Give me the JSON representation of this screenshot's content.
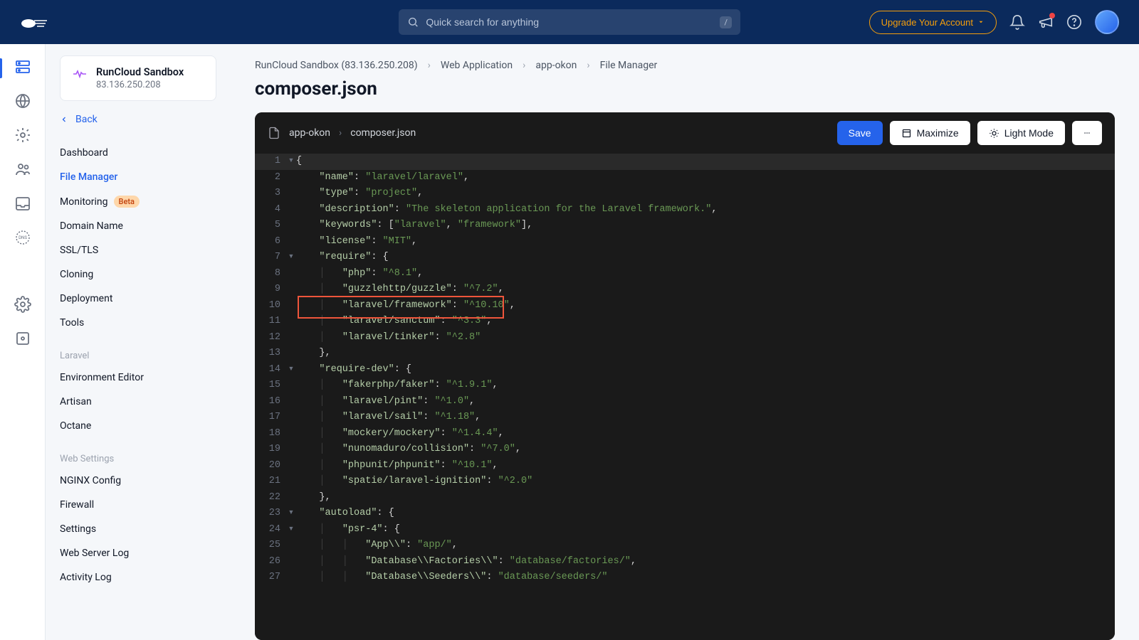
{
  "header": {
    "search_placeholder": "Quick search for anything",
    "search_kbd": "/",
    "upgrade_label": "Upgrade Your Account"
  },
  "server_card": {
    "title": "RunCloud Sandbox",
    "ip": "83.136.250.208"
  },
  "back_label": "Back",
  "nav": {
    "items": [
      {
        "label": "Dashboard"
      },
      {
        "label": "File Manager"
      },
      {
        "label": "Monitoring",
        "badge": "Beta"
      },
      {
        "label": "Domain Name"
      },
      {
        "label": "SSL/TLS"
      },
      {
        "label": "Cloning"
      },
      {
        "label": "Deployment"
      },
      {
        "label": "Tools"
      }
    ],
    "group1_label": "Laravel",
    "group1": [
      {
        "label": "Environment Editor"
      },
      {
        "label": "Artisan"
      },
      {
        "label": "Octane"
      }
    ],
    "group2_label": "Web Settings",
    "group2": [
      {
        "label": "NGINX Config"
      },
      {
        "label": "Firewall"
      },
      {
        "label": "Settings"
      },
      {
        "label": "Web Server Log"
      },
      {
        "label": "Activity Log"
      }
    ]
  },
  "breadcrumb": {
    "c1": "RunCloud Sandbox (83.136.250.208)",
    "c2": "Web Application",
    "c3": "app-okon",
    "c4": "File Manager"
  },
  "page_title": "composer.json",
  "toolbar": {
    "path1": "app-okon",
    "path2": "composer.json",
    "save": "Save",
    "maximize": "Maximize",
    "light": "Light Mode"
  },
  "code": {
    "lines": [
      {
        "n": 1,
        "fold": "▾",
        "tokens": [
          [
            "ob",
            "{"
          ]
        ]
      },
      {
        "n": 2,
        "tokens": [
          [
            "ws",
            "    "
          ],
          [
            "key",
            "\"name\""
          ],
          [
            "punc",
            ": "
          ],
          [
            "str",
            "\"laravel/laravel\""
          ],
          [
            "punc",
            ","
          ]
        ]
      },
      {
        "n": 3,
        "tokens": [
          [
            "ws",
            "    "
          ],
          [
            "key",
            "\"type\""
          ],
          [
            "punc",
            ": "
          ],
          [
            "str",
            "\"project\""
          ],
          [
            "punc",
            ","
          ]
        ]
      },
      {
        "n": 4,
        "tokens": [
          [
            "ws",
            "    "
          ],
          [
            "key",
            "\"description\""
          ],
          [
            "punc",
            ": "
          ],
          [
            "str",
            "\"The skeleton application for the Laravel framework.\""
          ],
          [
            "punc",
            ","
          ]
        ]
      },
      {
        "n": 5,
        "tokens": [
          [
            "ws",
            "    "
          ],
          [
            "key",
            "\"keywords\""
          ],
          [
            "punc",
            ": ["
          ],
          [
            "str",
            "\"laravel\""
          ],
          [
            "punc",
            ", "
          ],
          [
            "str",
            "\"framework\""
          ],
          [
            "punc",
            "],"
          ]
        ]
      },
      {
        "n": 6,
        "tokens": [
          [
            "ws",
            "    "
          ],
          [
            "key",
            "\"license\""
          ],
          [
            "punc",
            ": "
          ],
          [
            "str",
            "\"MIT\""
          ],
          [
            "punc",
            ","
          ]
        ]
      },
      {
        "n": 7,
        "fold": "▾",
        "tokens": [
          [
            "ws",
            "    "
          ],
          [
            "key",
            "\"require\""
          ],
          [
            "punc",
            ": {"
          ]
        ]
      },
      {
        "n": 8,
        "tokens": [
          [
            "ws",
            "    "
          ],
          [
            "guide",
            "│   "
          ],
          [
            "key",
            "\"php\""
          ],
          [
            "punc",
            ": "
          ],
          [
            "str",
            "\"^8.1\""
          ],
          [
            "punc",
            ","
          ]
        ]
      },
      {
        "n": 9,
        "tokens": [
          [
            "ws",
            "    "
          ],
          [
            "guide",
            "│   "
          ],
          [
            "key",
            "\"guzzlehttp/guzzle\""
          ],
          [
            "punc",
            ": "
          ],
          [
            "str",
            "\"^7.2\""
          ],
          [
            "punc",
            ","
          ]
        ]
      },
      {
        "n": 10,
        "highlight": true,
        "tokens": [
          [
            "ws",
            "    "
          ],
          [
            "guide",
            "│   "
          ],
          [
            "key",
            "\"laravel/framework\""
          ],
          [
            "punc",
            ": "
          ],
          [
            "str",
            "\"^10.10\""
          ],
          [
            "punc",
            ","
          ]
        ]
      },
      {
        "n": 11,
        "tokens": [
          [
            "ws",
            "    "
          ],
          [
            "guide",
            "│   "
          ],
          [
            "key",
            "\"laravel/sanctum\""
          ],
          [
            "punc",
            ": "
          ],
          [
            "str",
            "\"^3.3\""
          ],
          [
            "punc",
            ","
          ]
        ]
      },
      {
        "n": 12,
        "tokens": [
          [
            "ws",
            "    "
          ],
          [
            "guide",
            "│   "
          ],
          [
            "key",
            "\"laravel/tinker\""
          ],
          [
            "punc",
            ": "
          ],
          [
            "str",
            "\"^2.8\""
          ]
        ]
      },
      {
        "n": 13,
        "tokens": [
          [
            "ws",
            "    "
          ],
          [
            "punc",
            "},"
          ]
        ]
      },
      {
        "n": 14,
        "fold": "▾",
        "tokens": [
          [
            "ws",
            "    "
          ],
          [
            "key",
            "\"require-dev\""
          ],
          [
            "punc",
            ": {"
          ]
        ]
      },
      {
        "n": 15,
        "tokens": [
          [
            "ws",
            "    "
          ],
          [
            "guide",
            "│   "
          ],
          [
            "key",
            "\"fakerphp/faker\""
          ],
          [
            "punc",
            ": "
          ],
          [
            "str",
            "\"^1.9.1\""
          ],
          [
            "punc",
            ","
          ]
        ]
      },
      {
        "n": 16,
        "tokens": [
          [
            "ws",
            "    "
          ],
          [
            "guide",
            "│   "
          ],
          [
            "key",
            "\"laravel/pint\""
          ],
          [
            "punc",
            ": "
          ],
          [
            "str",
            "\"^1.0\""
          ],
          [
            "punc",
            ","
          ]
        ]
      },
      {
        "n": 17,
        "tokens": [
          [
            "ws",
            "    "
          ],
          [
            "guide",
            "│   "
          ],
          [
            "key",
            "\"laravel/sail\""
          ],
          [
            "punc",
            ": "
          ],
          [
            "str",
            "\"^1.18\""
          ],
          [
            "punc",
            ","
          ]
        ]
      },
      {
        "n": 18,
        "tokens": [
          [
            "ws",
            "    "
          ],
          [
            "guide",
            "│   "
          ],
          [
            "key",
            "\"mockery/mockery\""
          ],
          [
            "punc",
            ": "
          ],
          [
            "str",
            "\"^1.4.4\""
          ],
          [
            "punc",
            ","
          ]
        ]
      },
      {
        "n": 19,
        "tokens": [
          [
            "ws",
            "    "
          ],
          [
            "guide",
            "│   "
          ],
          [
            "key",
            "\"nunomaduro/collision\""
          ],
          [
            "punc",
            ": "
          ],
          [
            "str",
            "\"^7.0\""
          ],
          [
            "punc",
            ","
          ]
        ]
      },
      {
        "n": 20,
        "tokens": [
          [
            "ws",
            "    "
          ],
          [
            "guide",
            "│   "
          ],
          [
            "key",
            "\"phpunit/phpunit\""
          ],
          [
            "punc",
            ": "
          ],
          [
            "str",
            "\"^10.1\""
          ],
          [
            "punc",
            ","
          ]
        ]
      },
      {
        "n": 21,
        "tokens": [
          [
            "ws",
            "    "
          ],
          [
            "guide",
            "│   "
          ],
          [
            "key",
            "\"spatie/laravel-ignition\""
          ],
          [
            "punc",
            ": "
          ],
          [
            "str",
            "\"^2.0\""
          ]
        ]
      },
      {
        "n": 22,
        "tokens": [
          [
            "ws",
            "    "
          ],
          [
            "punc",
            "},"
          ]
        ]
      },
      {
        "n": 23,
        "fold": "▾",
        "tokens": [
          [
            "ws",
            "    "
          ],
          [
            "key",
            "\"autoload\""
          ],
          [
            "punc",
            ": {"
          ]
        ]
      },
      {
        "n": 24,
        "fold": "▾",
        "tokens": [
          [
            "ws",
            "    "
          ],
          [
            "guide",
            "│   "
          ],
          [
            "key",
            "\"psr-4\""
          ],
          [
            "punc",
            ": {"
          ]
        ]
      },
      {
        "n": 25,
        "tokens": [
          [
            "ws",
            "    "
          ],
          [
            "guide",
            "│   │   "
          ],
          [
            "key",
            "\"App\\\\\\\\\""
          ],
          [
            "punc",
            ": "
          ],
          [
            "str",
            "\"app/\""
          ],
          [
            "punc",
            ","
          ]
        ]
      },
      {
        "n": 26,
        "tokens": [
          [
            "ws",
            "    "
          ],
          [
            "guide",
            "│   │   "
          ],
          [
            "key",
            "\"Database\\\\\\\\Factories\\\\\\\\\""
          ],
          [
            "punc",
            ": "
          ],
          [
            "str",
            "\"database/factories/\""
          ],
          [
            "punc",
            ","
          ]
        ]
      },
      {
        "n": 27,
        "tokens": [
          [
            "ws",
            "    "
          ],
          [
            "guide",
            "│   │   "
          ],
          [
            "key",
            "\"Database\\\\\\\\Seeders\\\\\\\\\""
          ],
          [
            "punc",
            ": "
          ],
          [
            "str",
            "\"database/seeders/\""
          ]
        ]
      }
    ]
  }
}
